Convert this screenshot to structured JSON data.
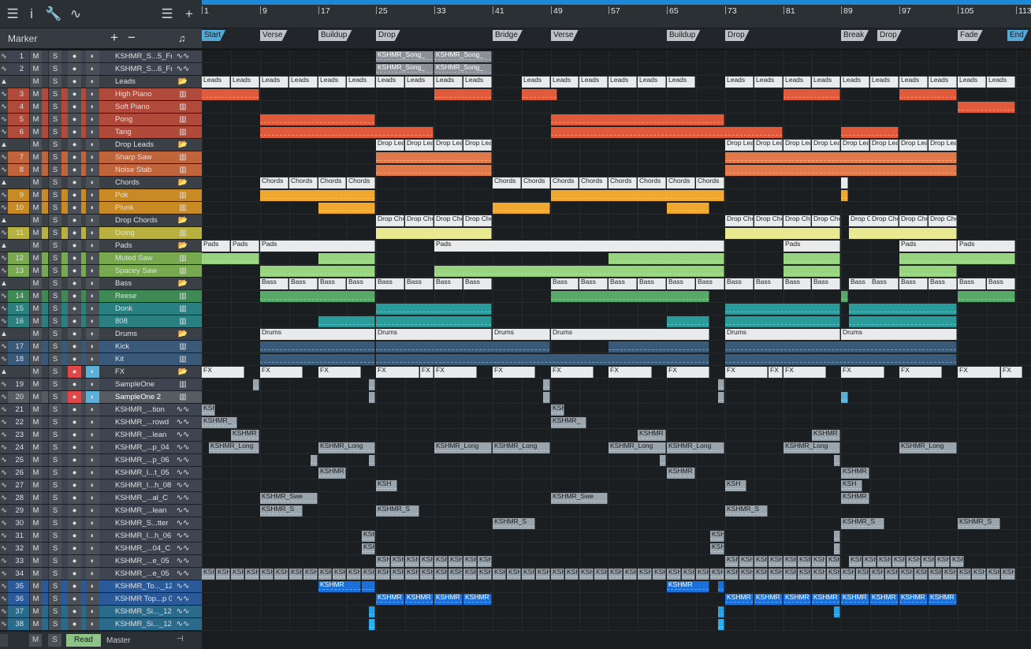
{
  "ruler": {
    "bars": [
      "1",
      "9",
      "17",
      "25",
      "33",
      "41",
      "49",
      "57",
      "65",
      "73",
      "81",
      "89",
      "97",
      "105",
      "113"
    ]
  },
  "marker_header": {
    "label": "Marker",
    "add": "+",
    "remove": "−",
    "note": "♫"
  },
  "markers": [
    "Start",
    "Verse",
    "Buildup",
    "Drop",
    "Bridge",
    "Verse",
    "Buildup",
    "Drop",
    "Break",
    "Drop",
    "Fade",
    "End"
  ],
  "tracks": [
    {
      "num": "1",
      "name": "KSHMR_S...5_Fm",
      "color": "#3f4550",
      "type": "audio"
    },
    {
      "num": "2",
      "name": "KSHMR_S...6_Fm",
      "color": "#3f4550",
      "type": "audio"
    },
    {
      "num": "",
      "name": "Leads",
      "color": "#4a5056",
      "type": "folder"
    },
    {
      "num": "3",
      "name": "High Piano",
      "color": "#b04a3a",
      "type": "inst"
    },
    {
      "num": "4",
      "name": "Soft Piano",
      "color": "#b04a3a",
      "type": "inst"
    },
    {
      "num": "5",
      "name": "Pong",
      "color": "#b04a3a",
      "type": "inst"
    },
    {
      "num": "6",
      "name": "Tang",
      "color": "#b04a3a",
      "type": "inst"
    },
    {
      "num": "",
      "name": "Drop Leads",
      "color": "#4a5056",
      "type": "folder"
    },
    {
      "num": "7",
      "name": "Sharp Saw",
      "color": "#c0643c",
      "type": "inst"
    },
    {
      "num": "8",
      "name": "Noise Stab",
      "color": "#c0643c",
      "type": "inst"
    },
    {
      "num": "",
      "name": "Chords",
      "color": "#4a5056",
      "type": "folder"
    },
    {
      "num": "9",
      "name": "Pok",
      "color": "#c88a24",
      "type": "inst"
    },
    {
      "num": "10",
      "name": "Plunk",
      "color": "#c88a24",
      "type": "inst"
    },
    {
      "num": "",
      "name": "Drop Chords",
      "color": "#4a5056",
      "type": "folder"
    },
    {
      "num": "11",
      "name": "Doing",
      "color": "#b8b040",
      "type": "inst"
    },
    {
      "num": "",
      "name": "Pads",
      "color": "#4a5056",
      "type": "folder"
    },
    {
      "num": "12",
      "name": "Muted Saw",
      "color": "#78a850",
      "type": "inst"
    },
    {
      "num": "13",
      "name": "Spacey Saw",
      "color": "#78a850",
      "type": "inst"
    },
    {
      "num": "",
      "name": "Bass",
      "color": "#4a5056",
      "type": "folder"
    },
    {
      "num": "14",
      "name": "Reese",
      "color": "#3f8a54",
      "type": "inst"
    },
    {
      "num": "15",
      "name": "Donk",
      "color": "#2a8080",
      "type": "inst"
    },
    {
      "num": "16",
      "name": "808",
      "color": "#2a8080",
      "type": "inst"
    },
    {
      "num": "",
      "name": "Drums",
      "color": "#4a5056",
      "type": "folder"
    },
    {
      "num": "17",
      "name": "Kick",
      "color": "#3a5878",
      "type": "inst"
    },
    {
      "num": "18",
      "name": "Kit",
      "color": "#3a5878",
      "type": "inst"
    },
    {
      "num": "",
      "name": "FX",
      "color": "#4a5056",
      "type": "folder"
    },
    {
      "num": "19",
      "name": "SampleOne",
      "color": "#3f4550",
      "type": "inst"
    },
    {
      "num": "20",
      "name": "SampleOne 2",
      "color": "#565c62",
      "type": "inst"
    },
    {
      "num": "21",
      "name": "KSHMR_...tion",
      "color": "#3f4550",
      "type": "audio"
    },
    {
      "num": "22",
      "name": "KSHMR_...rowd",
      "color": "#3f4550",
      "type": "audio"
    },
    {
      "num": "23",
      "name": "KSHMR_...lean",
      "color": "#3f4550",
      "type": "audio"
    },
    {
      "num": "24",
      "name": "KSHMR_...p_04",
      "color": "#3f4550",
      "type": "audio"
    },
    {
      "num": "25",
      "name": "KSHMR_...p_06",
      "color": "#3f4550",
      "type": "audio"
    },
    {
      "num": "26",
      "name": "KSHMR_I...t_05",
      "color": "#3f4550",
      "type": "audio"
    },
    {
      "num": "27",
      "name": "KSHMR_I...h_08",
      "color": "#3f4550",
      "type": "audio"
    },
    {
      "num": "28",
      "name": "KSHMR_...al_C",
      "color": "#3f4550",
      "type": "audio"
    },
    {
      "num": "29",
      "name": "KSHMR_...lean",
      "color": "#3f4550",
      "type": "audio"
    },
    {
      "num": "30",
      "name": "KSHMR_S...tter",
      "color": "#3f4550",
      "type": "audio"
    },
    {
      "num": "31",
      "name": "KSHMR_I...h_06",
      "color": "#3f4550",
      "type": "audio"
    },
    {
      "num": "32",
      "name": "KSHMR_...04_C",
      "color": "#3f4550",
      "type": "audio"
    },
    {
      "num": "33",
      "name": "KSHMR_...e_05",
      "color": "#3f4550",
      "type": "audio"
    },
    {
      "num": "34",
      "name": "KSHMR_...e_05",
      "color": "#3f4550",
      "type": "audio"
    },
    {
      "num": "35",
      "name": "KSHMR_To..._124",
      "color": "#2a5a9a",
      "type": "audio"
    },
    {
      "num": "36",
      "name": "KSHMR Top...p 02",
      "color": "#2a5a9a",
      "type": "audio"
    },
    {
      "num": "37",
      "name": "KSHMR_Si..._128",
      "color": "#2a6a8a",
      "type": "audio"
    },
    {
      "num": "38",
      "name": "KSHMR_Si..._128",
      "color": "#2a6a8a",
      "type": "audio"
    }
  ],
  "footer": {
    "read": "Read",
    "master": "Master"
  },
  "labels": {
    "m": "M",
    "s": "S"
  }
}
